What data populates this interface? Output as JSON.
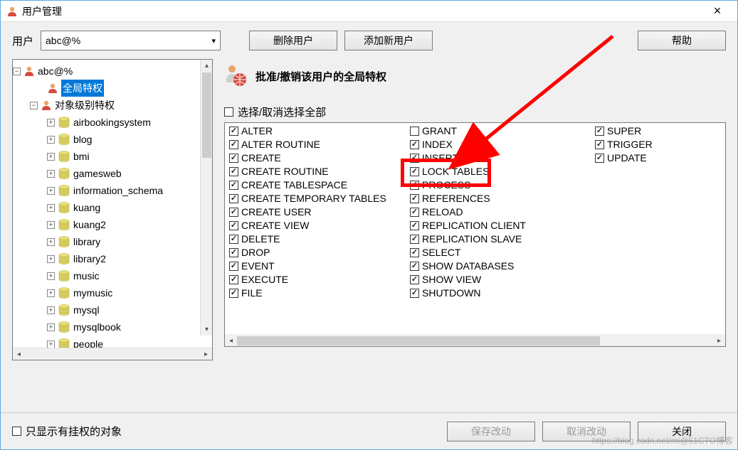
{
  "window": {
    "title": "用户管理",
    "close": "×"
  },
  "toolbar": {
    "user_label": "用户",
    "user_value": "abc@%",
    "delete_user": "删除用户",
    "add_user": "添加新用户",
    "help": "帮助"
  },
  "tree": {
    "root": "abc@%",
    "global_priv": "全局特权",
    "object_priv": "对象级别特权",
    "databases": [
      "airbookingsystem",
      "blog",
      "bmi",
      "gamesweb",
      "information_schema",
      "kuang",
      "kuang2",
      "library",
      "library2",
      "music",
      "mymusic",
      "mysql",
      "mysqlbook",
      "people"
    ]
  },
  "right": {
    "header": "批准/撤销该用户的全局特权",
    "select_all": "选择/取消选择全部"
  },
  "privs": {
    "col1": [
      {
        "label": "ALTER",
        "on": true
      },
      {
        "label": "ALTER ROUTINE",
        "on": true
      },
      {
        "label": "CREATE",
        "on": true
      },
      {
        "label": "CREATE ROUTINE",
        "on": true
      },
      {
        "label": "CREATE TABLESPACE",
        "on": true
      },
      {
        "label": "CREATE TEMPORARY TABLES",
        "on": true
      },
      {
        "label": "CREATE USER",
        "on": true
      },
      {
        "label": "CREATE VIEW",
        "on": true
      },
      {
        "label": "DELETE",
        "on": true
      },
      {
        "label": "DROP",
        "on": true
      },
      {
        "label": "EVENT",
        "on": true
      },
      {
        "label": "EXECUTE",
        "on": true
      },
      {
        "label": "FILE",
        "on": true
      }
    ],
    "col2": [
      {
        "label": "GRANT",
        "on": false
      },
      {
        "label": "INDEX",
        "on": true
      },
      {
        "label": "INSERT",
        "on": true
      },
      {
        "label": "LOCK TABLES",
        "on": true
      },
      {
        "label": "PROCESS",
        "on": true
      },
      {
        "label": "REFERENCES",
        "on": true
      },
      {
        "label": "RELOAD",
        "on": true
      },
      {
        "label": "REPLICATION CLIENT",
        "on": true
      },
      {
        "label": "REPLICATION SLAVE",
        "on": true
      },
      {
        "label": "SELECT",
        "on": true
      },
      {
        "label": "SHOW DATABASES",
        "on": true
      },
      {
        "label": "SHOW VIEW",
        "on": true
      },
      {
        "label": "SHUTDOWN",
        "on": true
      }
    ],
    "col3": [
      {
        "label": "SUPER",
        "on": true
      },
      {
        "label": "TRIGGER",
        "on": true
      },
      {
        "label": "UPDATE",
        "on": true
      }
    ]
  },
  "bottom": {
    "only_priv": "只显示有挂权的对象",
    "save": "保存改动",
    "cancel": "取消改动",
    "close": "关闭"
  },
  "watermark": "https://blog.csdn.net/mi@51CTO博客"
}
